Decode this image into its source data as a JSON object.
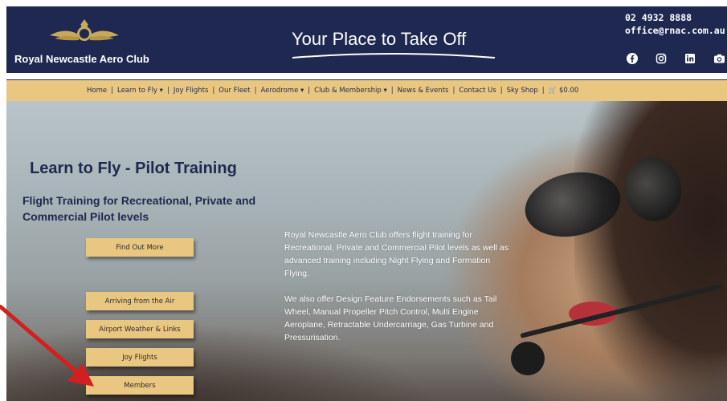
{
  "header": {
    "brand": "Royal Newcastle Aero Club",
    "tagline": "Your Place to Take Off",
    "phone": "02 4932 8888",
    "email": "office@rnac.com.au",
    "social_icons": [
      "facebook-icon",
      "instagram-icon",
      "linkedin-icon",
      "camera-icon"
    ]
  },
  "nav": {
    "items": [
      {
        "label": "Home"
      },
      {
        "label": "Learn to Fly ▾"
      },
      {
        "label": "Joy Flights"
      },
      {
        "label": "Our Fleet"
      },
      {
        "label": "Aerodrome ▾"
      },
      {
        "label": "Club & Membership ▾"
      },
      {
        "label": "News & Events"
      },
      {
        "label": "Contact Us"
      },
      {
        "label": "Sky Shop"
      },
      {
        "label": "🛒 $0.00"
      }
    ]
  },
  "hero": {
    "title": "Learn to Fly - Pilot Training",
    "subtitle": "Flight Training for Recreational, Private and Commercial Pilot levels",
    "paragraph1": "Royal Newcastle Aero Club offers flight training for Recreational, Private and Commercial Pilot levels as well as advanced training including Night Flying and Formation Flying.",
    "paragraph2": "We also offer Design Feature Endorsements such as Tail Wheel, Manual Propeller Pitch Control, Multi Engine Aeroplane, Retractable Undercarriage, Gas Turbine and Pressurisation."
  },
  "buttons": {
    "find_out_more": "Find Out More",
    "arriving": "Arriving from the Air",
    "weather": "Airport Weather & Links",
    "joy": "Joy Flights",
    "members": "Members"
  },
  "colors": {
    "navy": "#1e2850",
    "gold": "#e9c781",
    "arrow": "#d21f1f"
  }
}
